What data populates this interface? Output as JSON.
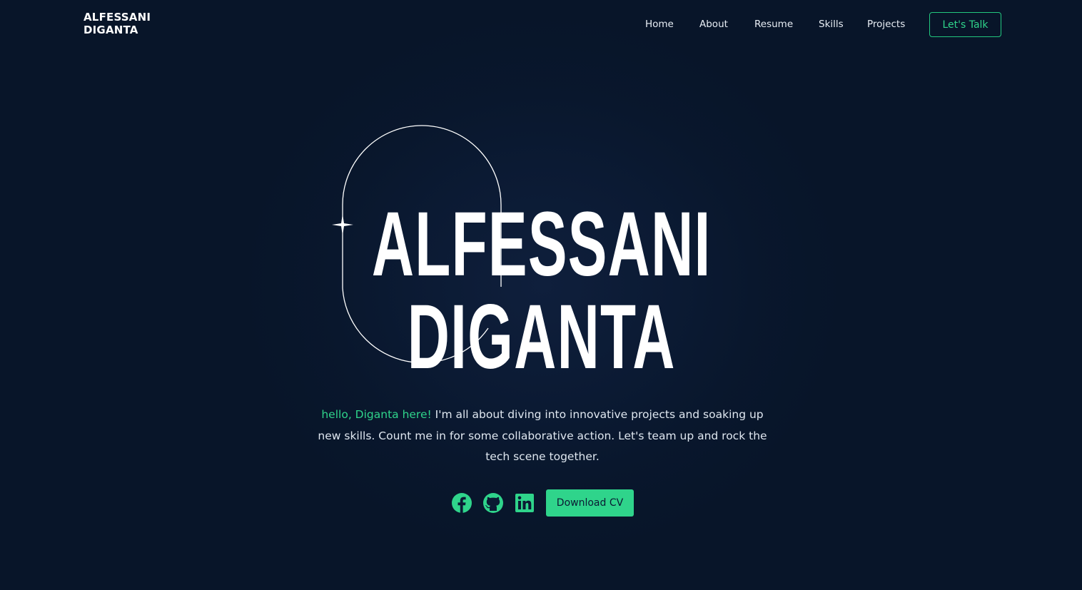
{
  "brand": {
    "line1": "ALFESSANI",
    "line2": "DIGANTA"
  },
  "nav": {
    "items": [
      "Home",
      "About",
      "Resume",
      "Skills",
      "Projects"
    ],
    "cta_label": "Let's Talk"
  },
  "hero": {
    "title_line1": "ALFESSANI",
    "title_line2": "DIGANTA",
    "intro_highlight": "hello, Diganta here!",
    "intro_line1_rest": " I'm all about diving into innovative projects and soaking up",
    "intro_line2": "new skills. Count me in for some collaborative action. Let's team up and rock the",
    "intro_line3": "tech scene together."
  },
  "socials": {
    "icons": [
      "facebook-icon",
      "github-icon",
      "linkedin-icon"
    ],
    "download_label": "Download CV"
  },
  "colors": {
    "background": "#0b1a33",
    "accent": "#2fd48b",
    "text": "#ffffff"
  }
}
